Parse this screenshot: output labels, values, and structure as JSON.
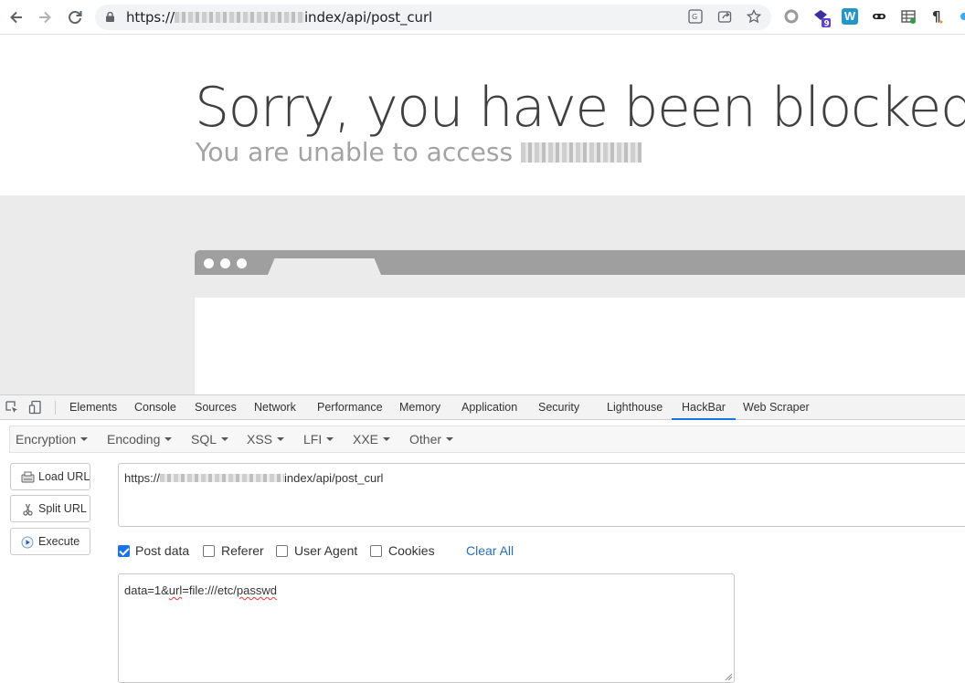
{
  "browser": {
    "url_prefix": "https://",
    "url_suffix": "index/api/post_curl",
    "extension_badge": "9",
    "extension_w": "W"
  },
  "blocked_page": {
    "headline": "Sorry, you have been blocked",
    "subline": "You are unable to access"
  },
  "devtools": {
    "tabs": [
      "Elements",
      "Console",
      "Sources",
      "Network",
      "Performance",
      "Memory",
      "Application",
      "Security",
      "Lighthouse",
      "HackBar",
      "Web Scraper"
    ],
    "active_tab": "HackBar"
  },
  "hackbar": {
    "menu": [
      "Encryption",
      "Encoding",
      "SQL",
      "XSS",
      "LFI",
      "XXE",
      "Other"
    ],
    "buttons": {
      "load_url": "Load URL",
      "split_url": "Split URL",
      "execute": "Execute"
    },
    "url_prefix": "https://",
    "url_suffix": "index/api/post_curl",
    "options": {
      "post_data": "Post data",
      "referer": "Referer",
      "user_agent": "User Agent",
      "cookies": "Cookies"
    },
    "post_data_checked": true,
    "clear_all": "Clear All",
    "post_body": {
      "p1": "data=1&",
      "p2": "url",
      "p3": "=file:///etc/",
      "p4": "passwd"
    }
  },
  "colors": {
    "accent": "#1a73e8",
    "link": "#2a6fbb",
    "headline": "#404040"
  }
}
